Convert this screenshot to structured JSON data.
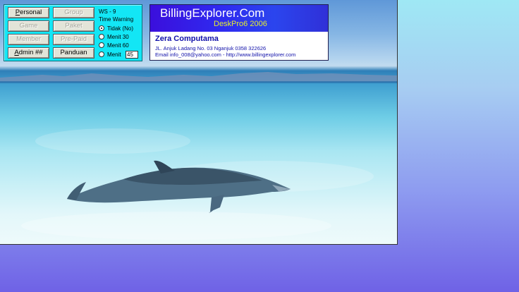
{
  "panel": {
    "buttons_left": [
      {
        "label": "Personal",
        "enabled": true,
        "hotkey_index": 0
      },
      {
        "label": "Game",
        "enabled": false,
        "hotkey_index": 0
      },
      {
        "label": "Member",
        "enabled": false,
        "hotkey_index": 0
      },
      {
        "label": "Admin ##",
        "enabled": true,
        "hotkey_index": 0
      }
    ],
    "buttons_right": [
      {
        "label": "Group",
        "enabled": false
      },
      {
        "label": "Paket",
        "enabled": false
      },
      {
        "label": "Pre-Paid",
        "enabled": false
      },
      {
        "label": "Panduan",
        "enabled": true
      }
    ],
    "workstation": "WS - 9",
    "time_warning_label": "Time Warning",
    "radio_options": [
      {
        "label": "Tidak (No)",
        "checked": true
      },
      {
        "label": "Menit  30",
        "checked": false
      },
      {
        "label": "Menit  60",
        "checked": false
      },
      {
        "label": "Menit",
        "checked": false
      }
    ],
    "custom_minutes_value": "45"
  },
  "brand": {
    "title": "BillingExplorer.Com",
    "subtitle": "DeskPro6 2006",
    "company_name": "Zera Computama",
    "address": "JL. Anjuk Ladang No. 03 Nganjuk 0358 322626",
    "contact": "Email info_008@yahoo.com - http://www.billingexplorer.com"
  },
  "colors": {
    "panel_bg": "#13e6f5",
    "brand_header": "#2f2af0",
    "subtitle": "#e5f02c",
    "company_text": "#1111aa"
  }
}
